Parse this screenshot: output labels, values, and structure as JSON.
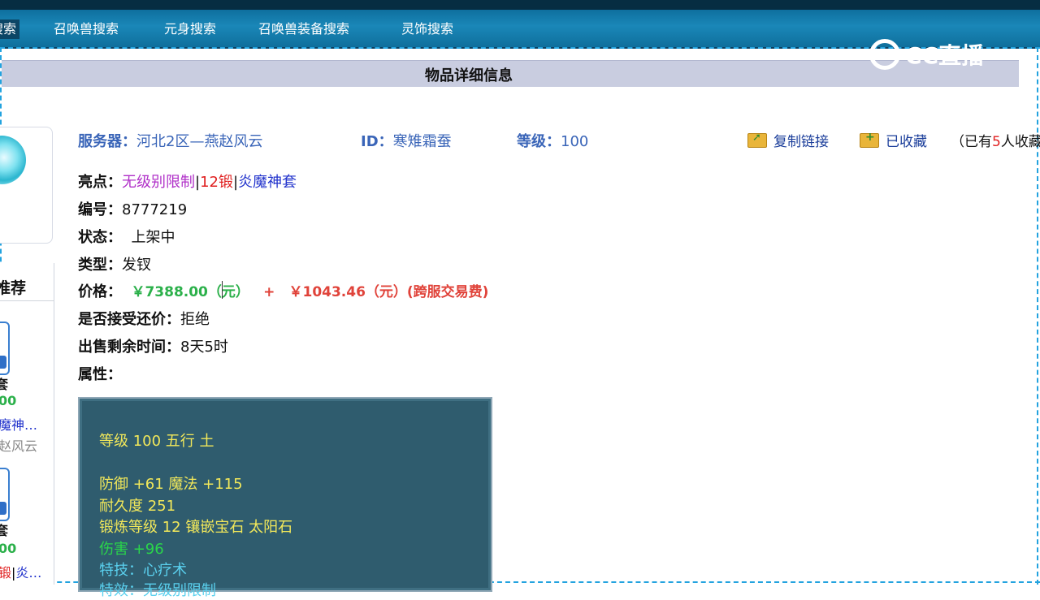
{
  "nav": {
    "items": [
      {
        "label": "搜索",
        "active": true
      },
      {
        "label": "召唤兽搜索"
      },
      {
        "label": "元身搜索"
      },
      {
        "label": "召唤兽装备搜索"
      },
      {
        "label": "灵饰搜索"
      }
    ]
  },
  "watermark": "CC直播",
  "page_title": "物品详细信息",
  "server": {
    "label": "服务器：",
    "value": "河北2区—燕赵风云",
    "id_label": "ID：",
    "id_value": "寒雉霜蚕",
    "level_label": "等级：",
    "level_value": "100"
  },
  "actions": {
    "copy_link": "复制链接",
    "favorited": "已收藏",
    "fav_count_prefix": "（已有",
    "fav_count": "5",
    "fav_count_suffix": "人收藏"
  },
  "details": {
    "highlights_label": "亮点：",
    "highlight_1": "无级别限制",
    "highlight_2": "12锻",
    "highlight_3": "炎魔神套",
    "sep": "|",
    "number_label": "编号：",
    "number_value": "8777219",
    "status_label": "状态：",
    "status_value": "上架中",
    "type_label": "类型：",
    "type_value": "发钗",
    "price_label": "价格：",
    "price_value": "￥7388.00（元）",
    "price_plus": "+",
    "fee_value": "￥1043.46（元）(跨服交易费)",
    "counter_label": "是否接受还价：",
    "counter_value": "拒绝",
    "remaining_label": "出售剩余时间：",
    "remaining_value": "8天5时",
    "attr_label": "属性："
  },
  "attributes": {
    "line1": "等级 100  五行 土",
    "line2": "防御 +61  魔法 +115",
    "line3": "耐久度 251",
    "line4": "锻炼等级 12  镶嵌宝石 太阳石",
    "line5": "伤害 +96",
    "line6": "特技：心疗术",
    "line7": "特效：无级别限制"
  },
  "sidebar": {
    "title": "推荐",
    "item1_name": "套",
    "item1_price": "00",
    "item1_desc": "魔神…",
    "item1_server": "赵风云",
    "item2_name": "套",
    "item2_price": "00",
    "item2_desc_a": "锻",
    "item2_desc_sep": "|",
    "item2_desc_b": "炎…"
  },
  "colors": {
    "nav_bg": "#1a87b8",
    "title_bar_bg": "#c9cde0",
    "label_blue": "#3a65b8",
    "price_green": "#2bb04a",
    "fee_red": "#e0433a",
    "highlight_purple": "#b030c8",
    "highlight_red": "#e02020",
    "highlight_blue": "#2233cc",
    "attr_bg": "#2f5c6e",
    "attr_yellow": "#f2e85a",
    "attr_green": "#2ad64a",
    "attr_cyan": "#5ad0ee"
  }
}
